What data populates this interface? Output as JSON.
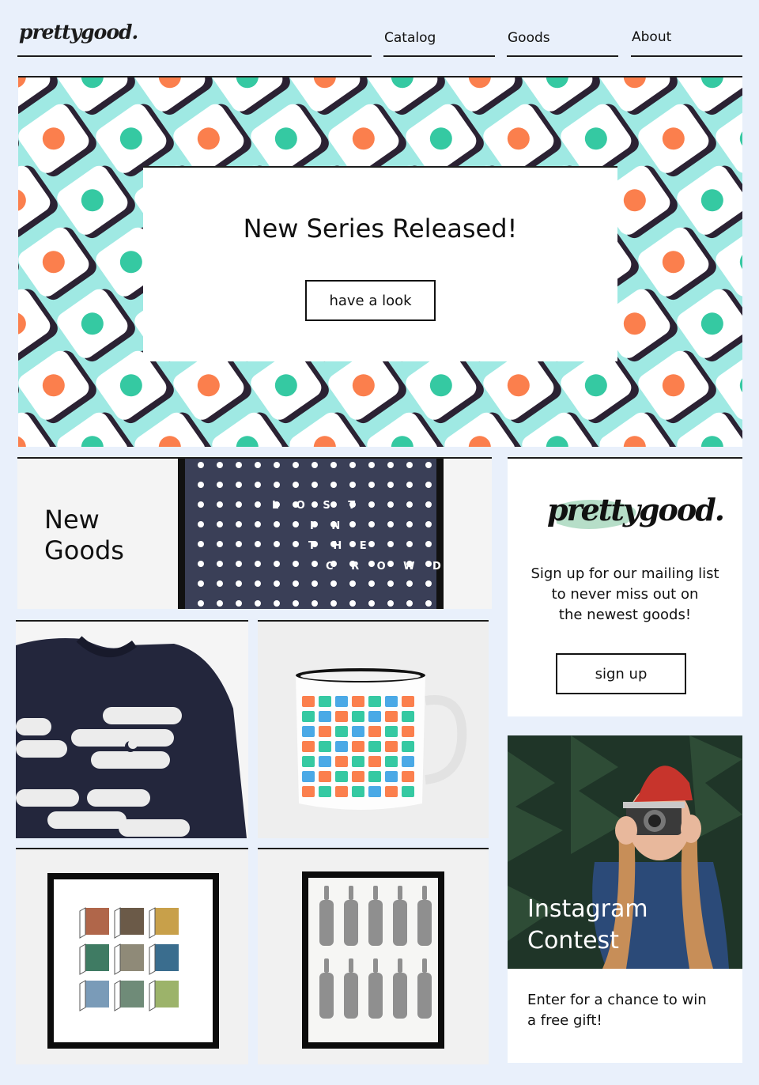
{
  "header": {
    "logo_text": "prettygood.",
    "nav": [
      {
        "label": "Catalog"
      },
      {
        "label": "Goods"
      },
      {
        "label": "About"
      }
    ]
  },
  "hero": {
    "title": "New Series Released!",
    "button_label": "have a look"
  },
  "new_goods": {
    "title_line1": "New",
    "title_line2": "Goods",
    "poster_words": [
      "L O S T",
      "I N",
      "T H E",
      "C R O W D"
    ]
  },
  "mailing": {
    "logo_text": "prettygood.",
    "text_lines": [
      "Sign up for our mailing list",
      "to never miss out on",
      "the newest goods!"
    ],
    "button_label": "sign up"
  },
  "instagram": {
    "overlay_line1": "Instagram",
    "overlay_line2": "Contest",
    "text_line1": "Enter for a chance to win",
    "text_line2": "a free gift!"
  },
  "colors": {
    "background": "#e9f0fb",
    "hero_teal": "#9fe9e3",
    "icon_teal": "#35c9a2",
    "icon_orange": "#fb7f4d",
    "navy": "#2e3246"
  }
}
